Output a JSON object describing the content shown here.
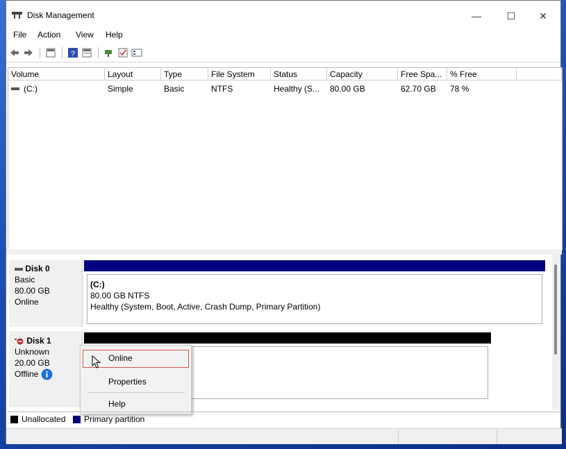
{
  "window": {
    "title": "Disk Management",
    "minimize": "—",
    "maximize": "☐",
    "close": "✕"
  },
  "menu": [
    "File",
    "Action",
    "View",
    "Help"
  ],
  "toolbar_icons": [
    "back-arrow-icon",
    "forward-arrow-icon",
    "view-icon",
    "help-icon",
    "list-icon",
    "rescan-icon",
    "check-icon",
    "properties-icon"
  ],
  "volume_list": {
    "headers": [
      "Volume",
      "Layout",
      "Type",
      "File System",
      "Status",
      "Capacity",
      "Free Spa...",
      "% Free"
    ],
    "rows": [
      [
        "(C:)",
        "Simple",
        "Basic",
        "NTFS",
        "Healthy (S...",
        "80.00 GB",
        "62.70 GB",
        "78 %"
      ]
    ]
  },
  "disks": [
    {
      "name": "Disk 0",
      "type": "Basic",
      "size": "80.00 GB",
      "state": "Online",
      "partition": {
        "name": "(C:)",
        "size_fs": "80.00 GB NTFS",
        "health": "Healthy (System, Boot, Active, Crash Dump, Primary Partition)"
      }
    },
    {
      "name": "Disk 1",
      "type": "Unknown",
      "size": "20.00 GB",
      "state": "Offline"
    }
  ],
  "context_menu": [
    "Online",
    "Properties",
    "Help"
  ],
  "legend": [
    "Unallocated",
    "Primary partition"
  ],
  "colors": {
    "primary_partition": "#00007f",
    "unallocated": "#000000",
    "highlight_border": "#d9534f",
    "info": "#1e6fd9"
  }
}
